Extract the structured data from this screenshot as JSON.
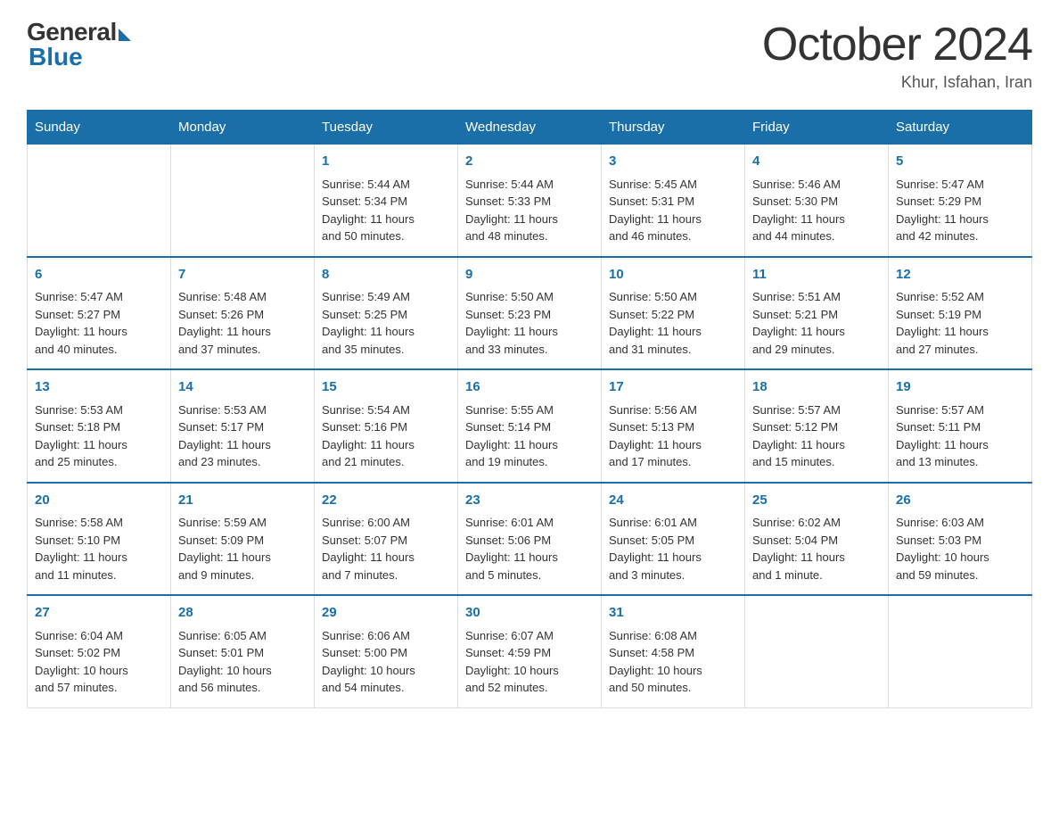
{
  "header": {
    "logo_general": "General",
    "logo_blue": "Blue",
    "month_title": "October 2024",
    "subtitle": "Khur, Isfahan, Iran"
  },
  "days_of_week": [
    "Sunday",
    "Monday",
    "Tuesday",
    "Wednesday",
    "Thursday",
    "Friday",
    "Saturday"
  ],
  "weeks": [
    [
      {
        "day": "",
        "info": ""
      },
      {
        "day": "",
        "info": ""
      },
      {
        "day": "1",
        "info": "Sunrise: 5:44 AM\nSunset: 5:34 PM\nDaylight: 11 hours\nand 50 minutes."
      },
      {
        "day": "2",
        "info": "Sunrise: 5:44 AM\nSunset: 5:33 PM\nDaylight: 11 hours\nand 48 minutes."
      },
      {
        "day": "3",
        "info": "Sunrise: 5:45 AM\nSunset: 5:31 PM\nDaylight: 11 hours\nand 46 minutes."
      },
      {
        "day": "4",
        "info": "Sunrise: 5:46 AM\nSunset: 5:30 PM\nDaylight: 11 hours\nand 44 minutes."
      },
      {
        "day": "5",
        "info": "Sunrise: 5:47 AM\nSunset: 5:29 PM\nDaylight: 11 hours\nand 42 minutes."
      }
    ],
    [
      {
        "day": "6",
        "info": "Sunrise: 5:47 AM\nSunset: 5:27 PM\nDaylight: 11 hours\nand 40 minutes."
      },
      {
        "day": "7",
        "info": "Sunrise: 5:48 AM\nSunset: 5:26 PM\nDaylight: 11 hours\nand 37 minutes."
      },
      {
        "day": "8",
        "info": "Sunrise: 5:49 AM\nSunset: 5:25 PM\nDaylight: 11 hours\nand 35 minutes."
      },
      {
        "day": "9",
        "info": "Sunrise: 5:50 AM\nSunset: 5:23 PM\nDaylight: 11 hours\nand 33 minutes."
      },
      {
        "day": "10",
        "info": "Sunrise: 5:50 AM\nSunset: 5:22 PM\nDaylight: 11 hours\nand 31 minutes."
      },
      {
        "day": "11",
        "info": "Sunrise: 5:51 AM\nSunset: 5:21 PM\nDaylight: 11 hours\nand 29 minutes."
      },
      {
        "day": "12",
        "info": "Sunrise: 5:52 AM\nSunset: 5:19 PM\nDaylight: 11 hours\nand 27 minutes."
      }
    ],
    [
      {
        "day": "13",
        "info": "Sunrise: 5:53 AM\nSunset: 5:18 PM\nDaylight: 11 hours\nand 25 minutes."
      },
      {
        "day": "14",
        "info": "Sunrise: 5:53 AM\nSunset: 5:17 PM\nDaylight: 11 hours\nand 23 minutes."
      },
      {
        "day": "15",
        "info": "Sunrise: 5:54 AM\nSunset: 5:16 PM\nDaylight: 11 hours\nand 21 minutes."
      },
      {
        "day": "16",
        "info": "Sunrise: 5:55 AM\nSunset: 5:14 PM\nDaylight: 11 hours\nand 19 minutes."
      },
      {
        "day": "17",
        "info": "Sunrise: 5:56 AM\nSunset: 5:13 PM\nDaylight: 11 hours\nand 17 minutes."
      },
      {
        "day": "18",
        "info": "Sunrise: 5:57 AM\nSunset: 5:12 PM\nDaylight: 11 hours\nand 15 minutes."
      },
      {
        "day": "19",
        "info": "Sunrise: 5:57 AM\nSunset: 5:11 PM\nDaylight: 11 hours\nand 13 minutes."
      }
    ],
    [
      {
        "day": "20",
        "info": "Sunrise: 5:58 AM\nSunset: 5:10 PM\nDaylight: 11 hours\nand 11 minutes."
      },
      {
        "day": "21",
        "info": "Sunrise: 5:59 AM\nSunset: 5:09 PM\nDaylight: 11 hours\nand 9 minutes."
      },
      {
        "day": "22",
        "info": "Sunrise: 6:00 AM\nSunset: 5:07 PM\nDaylight: 11 hours\nand 7 minutes."
      },
      {
        "day": "23",
        "info": "Sunrise: 6:01 AM\nSunset: 5:06 PM\nDaylight: 11 hours\nand 5 minutes."
      },
      {
        "day": "24",
        "info": "Sunrise: 6:01 AM\nSunset: 5:05 PM\nDaylight: 11 hours\nand 3 minutes."
      },
      {
        "day": "25",
        "info": "Sunrise: 6:02 AM\nSunset: 5:04 PM\nDaylight: 11 hours\nand 1 minute."
      },
      {
        "day": "26",
        "info": "Sunrise: 6:03 AM\nSunset: 5:03 PM\nDaylight: 10 hours\nand 59 minutes."
      }
    ],
    [
      {
        "day": "27",
        "info": "Sunrise: 6:04 AM\nSunset: 5:02 PM\nDaylight: 10 hours\nand 57 minutes."
      },
      {
        "day": "28",
        "info": "Sunrise: 6:05 AM\nSunset: 5:01 PM\nDaylight: 10 hours\nand 56 minutes."
      },
      {
        "day": "29",
        "info": "Sunrise: 6:06 AM\nSunset: 5:00 PM\nDaylight: 10 hours\nand 54 minutes."
      },
      {
        "day": "30",
        "info": "Sunrise: 6:07 AM\nSunset: 4:59 PM\nDaylight: 10 hours\nand 52 minutes."
      },
      {
        "day": "31",
        "info": "Sunrise: 6:08 AM\nSunset: 4:58 PM\nDaylight: 10 hours\nand 50 minutes."
      },
      {
        "day": "",
        "info": ""
      },
      {
        "day": "",
        "info": ""
      }
    ]
  ]
}
